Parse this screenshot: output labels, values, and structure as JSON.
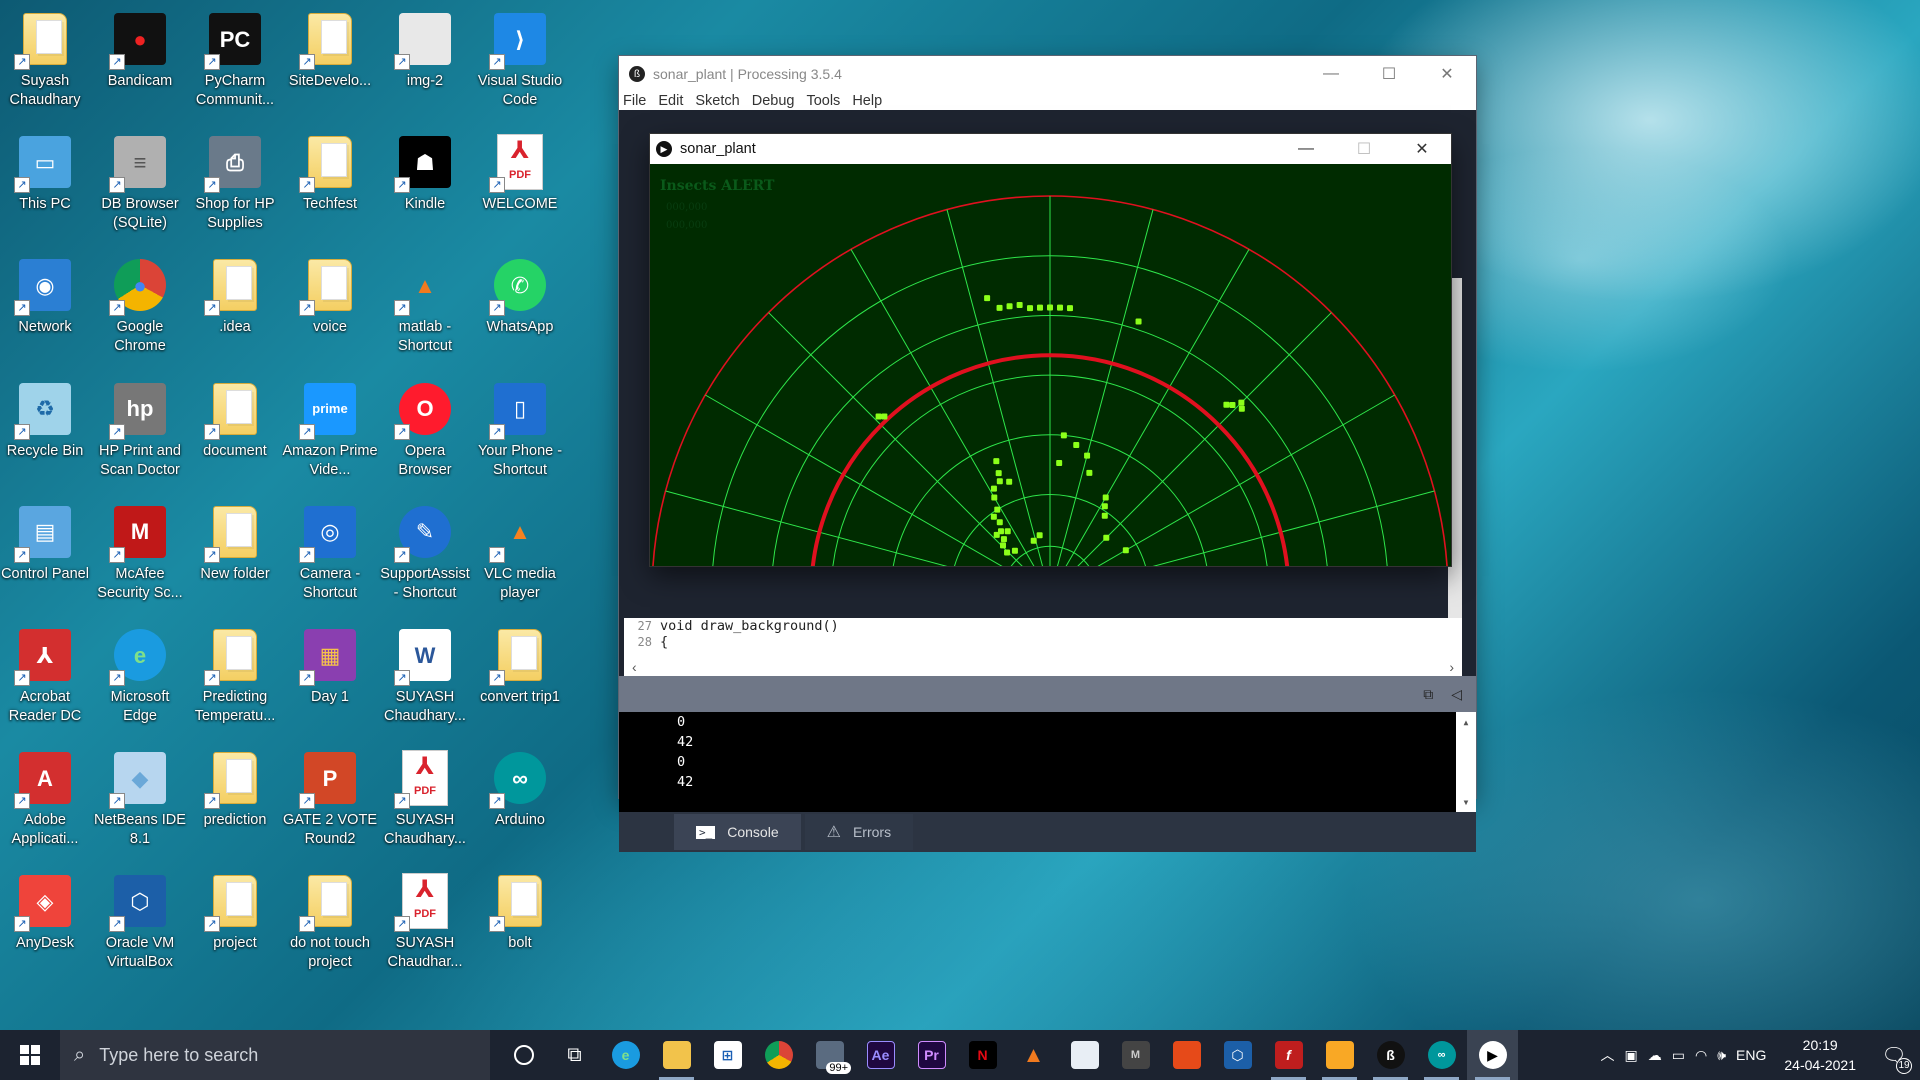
{
  "desktop": {
    "icons": [
      {
        "label": "Suyash Chaudhary",
        "icon": "user-folder-icon"
      },
      {
        "label": "Bandicam",
        "icon": "bandicam-icon"
      },
      {
        "label": "PyCharm Communit...",
        "icon": "pycharm-icon"
      },
      {
        "label": "SiteDevelo...",
        "icon": "folder-icon"
      },
      {
        "label": "img-2",
        "icon": "image-icon"
      },
      {
        "label": "Visual Studio Code",
        "icon": "vscode-icon"
      },
      {
        "label": "This PC",
        "icon": "this-pc-icon"
      },
      {
        "label": "DB Browser (SQLite)",
        "icon": "db-browser-icon"
      },
      {
        "label": "Shop for HP Supplies",
        "icon": "hp-supplies-icon"
      },
      {
        "label": "Techfest",
        "icon": "folder-icon"
      },
      {
        "label": "Kindle",
        "icon": "kindle-icon"
      },
      {
        "label": "WELCOME",
        "icon": "pdf-icon"
      },
      {
        "label": "Network",
        "icon": "network-icon"
      },
      {
        "label": "Google Chrome",
        "icon": "chrome-icon"
      },
      {
        "label": ".idea",
        "icon": "folder-icon"
      },
      {
        "label": "voice",
        "icon": "folder-icon"
      },
      {
        "label": "matlab - Shortcut",
        "icon": "matlab-icon"
      },
      {
        "label": "WhatsApp",
        "icon": "whatsapp-icon"
      },
      {
        "label": "Recycle Bin",
        "icon": "recycle-bin-icon"
      },
      {
        "label": "HP Print and Scan Doctor",
        "icon": "hp-print-icon"
      },
      {
        "label": "document",
        "icon": "folder-icon"
      },
      {
        "label": "Amazon Prime Vide...",
        "icon": "prime-video-icon"
      },
      {
        "label": "Opera Browser",
        "icon": "opera-icon"
      },
      {
        "label": "Your Phone - Shortcut",
        "icon": "your-phone-icon"
      },
      {
        "label": "Control Panel",
        "icon": "control-panel-icon"
      },
      {
        "label": "McAfee Security Sc...",
        "icon": "mcafee-icon"
      },
      {
        "label": "New folder",
        "icon": "folder-icon"
      },
      {
        "label": "Camera - Shortcut",
        "icon": "camera-icon"
      },
      {
        "label": "SupportAssist - Shortcut",
        "icon": "supportassist-icon"
      },
      {
        "label": "VLC media player",
        "icon": "vlc-icon"
      },
      {
        "label": "Acrobat Reader DC",
        "icon": "acrobat-icon"
      },
      {
        "label": "Microsoft Edge",
        "icon": "edge-icon"
      },
      {
        "label": "Predicting Temperatu...",
        "icon": "folder-icon"
      },
      {
        "label": "Day 1",
        "icon": "winrar-icon"
      },
      {
        "label": "SUYASH Chaudhary...",
        "icon": "word-icon"
      },
      {
        "label": "convert trip1",
        "icon": "folder-icon"
      },
      {
        "label": "Adobe Applicati...",
        "icon": "adobe-icon"
      },
      {
        "label": "NetBeans IDE 8.1",
        "icon": "netbeans-icon"
      },
      {
        "label": "prediction",
        "icon": "folder-icon"
      },
      {
        "label": "GATE 2 VOTE Round2",
        "icon": "powerpoint-icon"
      },
      {
        "label": "SUYASH Chaudhary...",
        "icon": "pdf-icon"
      },
      {
        "label": "Arduino",
        "icon": "arduino-icon"
      },
      {
        "label": "AnyDesk",
        "icon": "anydesk-icon"
      },
      {
        "label": "Oracle VM VirtualBox",
        "icon": "virtualbox-icon"
      },
      {
        "label": "project",
        "icon": "folder-icon"
      },
      {
        "label": "do not touch project",
        "icon": "folder-icon"
      },
      {
        "label": "SUYASH Chaudhar...",
        "icon": "pdf-icon"
      },
      {
        "label": "bolt",
        "icon": "folder-icon"
      }
    ]
  },
  "ide": {
    "title": "sonar_plant | Processing 3.5.4",
    "menu": [
      "File",
      "Edit",
      "Sketch",
      "Debug",
      "Tools",
      "Help"
    ],
    "editor": {
      "line27_no": "27",
      "line27": "void draw_background()",
      "line28_no": "28",
      "line28": "{"
    },
    "console_lines": [
      "0",
      "42",
      "0",
      "42"
    ],
    "tabs": {
      "console": "Console",
      "errors": "Errors"
    }
  },
  "sketch": {
    "title": "sonar_plant",
    "alert_text": "Insects ALERT",
    "faint_values": [
      "000,000",
      "000,000"
    ],
    "colors": {
      "background": "#002b00",
      "grid": "#2ee64a",
      "arc": "#e0101f",
      "points": "#8cff1a"
    }
  },
  "taskbar": {
    "search_placeholder": "Type here to search",
    "mail_badge": "99+",
    "language": "ENG",
    "time": "20:19",
    "date": "24-04-2021",
    "notification_count": "19"
  }
}
